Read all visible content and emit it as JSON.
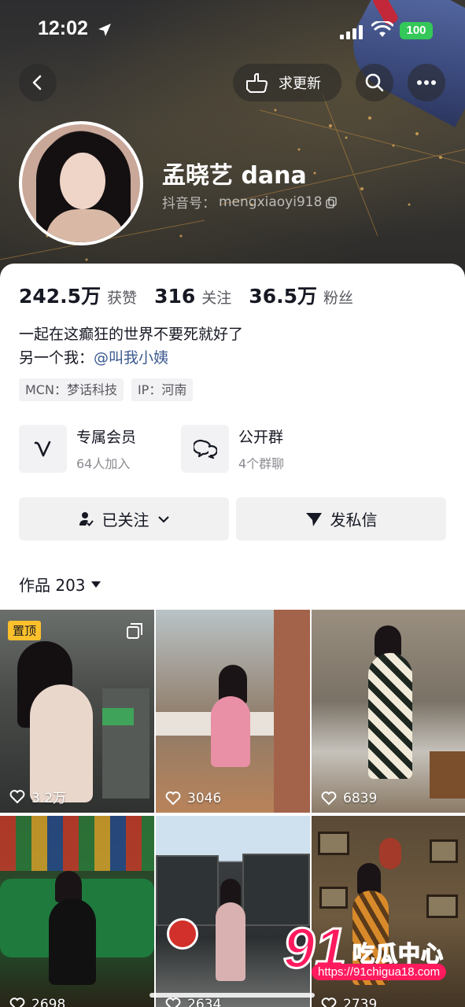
{
  "status_bar": {
    "time": "12:02",
    "battery": "100"
  },
  "nav": {
    "update_label": "求更新"
  },
  "profile": {
    "name": "孟晓艺 dana",
    "douyin_id_label": "抖音号：",
    "douyin_id": "mengxiaoyi918"
  },
  "stats": [
    {
      "value": "242.5万",
      "label": "获赞"
    },
    {
      "value": "316",
      "label": "关注"
    },
    {
      "value": "36.5万",
      "label": "粉丝"
    }
  ],
  "bio": {
    "line1": "一起在这癫狂的世界不要死就好了",
    "line2_prefix": "另一个我：",
    "line2_link": "@叫我小姨"
  },
  "tags": [
    "MCN：梦话科技",
    "IP：河南"
  ],
  "features": [
    {
      "title": "专属会员",
      "subtitle": "64人加入",
      "icon": "vip-icon"
    },
    {
      "title": "公开群",
      "subtitle": "4个群聊",
      "icon": "group-chat-icon"
    }
  ],
  "actions": {
    "follow_label": "已关注",
    "message_label": "发私信"
  },
  "works": {
    "label": "作品 203"
  },
  "videos": [
    {
      "likes": "3.2万",
      "pinned": "置顶"
    },
    {
      "likes": "3046"
    },
    {
      "likes": "6839"
    },
    {
      "likes": "2698"
    },
    {
      "likes": "2634"
    },
    {
      "likes": "2739"
    }
  ],
  "watermark": {
    "number": "91",
    "text": "吃瓜中心",
    "url": "https://91chigua18.com"
  },
  "colors": {
    "accent_link": "#3c5a8f",
    "pin_badge": "#fcc02c",
    "battery": "#34c759",
    "watermark": "#ff1a5e"
  }
}
